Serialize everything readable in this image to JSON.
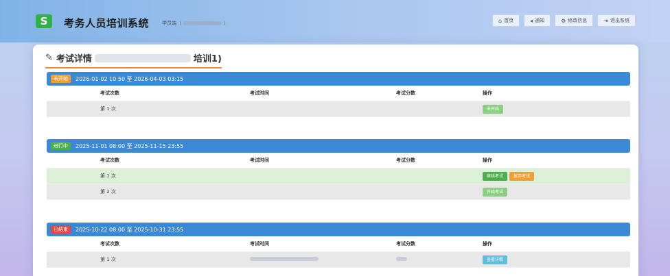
{
  "header": {
    "logo_text": "S",
    "app_title": "考务人员培训系统",
    "user_prefix": "学员端（",
    "user_suffix": "）"
  },
  "nav": [
    {
      "icon": "home-icon",
      "glyph": "⌂",
      "label": "首页"
    },
    {
      "icon": "megaphone-icon",
      "glyph": "◂",
      "label": "通知"
    },
    {
      "icon": "gear-icon",
      "glyph": "⚙",
      "label": "修改信息"
    },
    {
      "icon": "logout-icon",
      "glyph": "⇥",
      "label": "退出系统"
    }
  ],
  "panel": {
    "title_prefix": "考试详情",
    "title_suffix": "培训1)"
  },
  "table_headers": {
    "attempt": "考试次数",
    "time": "考试时间",
    "score": "考试分数",
    "action": "操作"
  },
  "sections": [
    {
      "status": "未开始",
      "status_color": "#f0a033",
      "period": "2026-01-02 10:50 至 2026-04-03 03:15",
      "rows": [
        {
          "attempt": "第 1 次",
          "time": "",
          "score": "",
          "actions": [
            {
              "label": "未开始",
              "color": "#8ccf83"
            }
          ]
        }
      ]
    },
    {
      "status": "进行中",
      "status_color": "#4cae4c",
      "period": "2025-11-01 08:00 至 2025-11-15 23:55",
      "rows": [
        {
          "attempt": "第 1 次",
          "time": "",
          "score": "",
          "actions": [
            {
              "label": "继续考试",
              "color": "#4cae4c"
            },
            {
              "label": "放弃考试",
              "color": "#f0a033"
            }
          ]
        },
        {
          "attempt": "第 2 次",
          "time": "",
          "score": "",
          "actions": [
            {
              "label": "开始考试",
              "color": "#8ccf83"
            }
          ]
        }
      ]
    },
    {
      "status": "已结束",
      "status_color": "#e04848",
      "period": "2025-10-22 08:00 至 2025-10-31 23:55",
      "rows": [
        {
          "attempt": "第 1 次",
          "time": "",
          "score": "",
          "actions": [
            {
              "label": "查看详情",
              "color": "#5bc0de"
            }
          ]
        }
      ]
    }
  ]
}
